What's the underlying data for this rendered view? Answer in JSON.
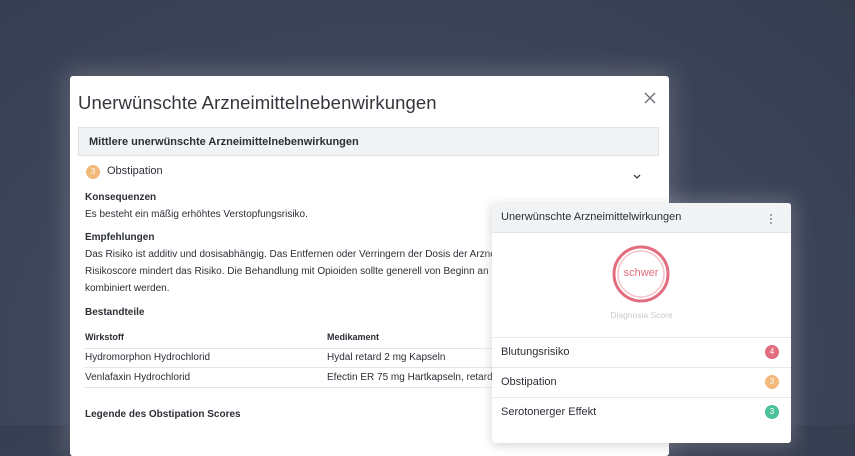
{
  "modal": {
    "title": "Unerwünschte Arzneimittelnebenwirkungen",
    "section_title": "Mittlere unerwünschte Arzneimittelnebenwirkungen",
    "item": {
      "score": "3",
      "label": "Obstipation"
    },
    "consequences": {
      "heading": "Konsequenzen",
      "text": "Es besteht ein mäßig erhöhtes Verstopfungsrisiko."
    },
    "recommendations": {
      "heading": "Empfehlungen",
      "lines": [
        "Das Risiko ist additiv und dosisabhängig. Das Entfernen oder Verringern der Dosis der Arzne",
        "Risikoscore mindert das Risiko. Die Behandlung mit Opioiden sollte generell von Beginn an m",
        "kombiniert werden."
      ]
    },
    "components": {
      "heading": "Bestandteile",
      "columns": [
        "Wirkstoff",
        "Medikament"
      ],
      "rows": [
        [
          "Hydromorphon Hydrochlorid",
          "Hydal retard 2 mg Kapseln"
        ],
        [
          "Venlafaxin Hydrochlorid",
          "Efectin ER 75 mg Hartkapseln, retardi"
        ]
      ]
    },
    "legend_heading": "Legende des Obstipation Scores"
  },
  "card": {
    "title": "Unerwünschte Arzneimittelwirkungen",
    "gauge_label": "schwer",
    "gauge_caption": "Diagnosia Score",
    "rows": [
      {
        "label": "Blutungsrisiko",
        "score": "4"
      },
      {
        "label": "Obstipation",
        "score": "3"
      },
      {
        "label": "Serotonerger Effekt",
        "score": "3"
      }
    ]
  },
  "colors": {
    "score_high": "#e26d7e",
    "score_medium": "#f2b97a",
    "score_low": "#4fc19a",
    "gauge": "#e26d7e"
  }
}
